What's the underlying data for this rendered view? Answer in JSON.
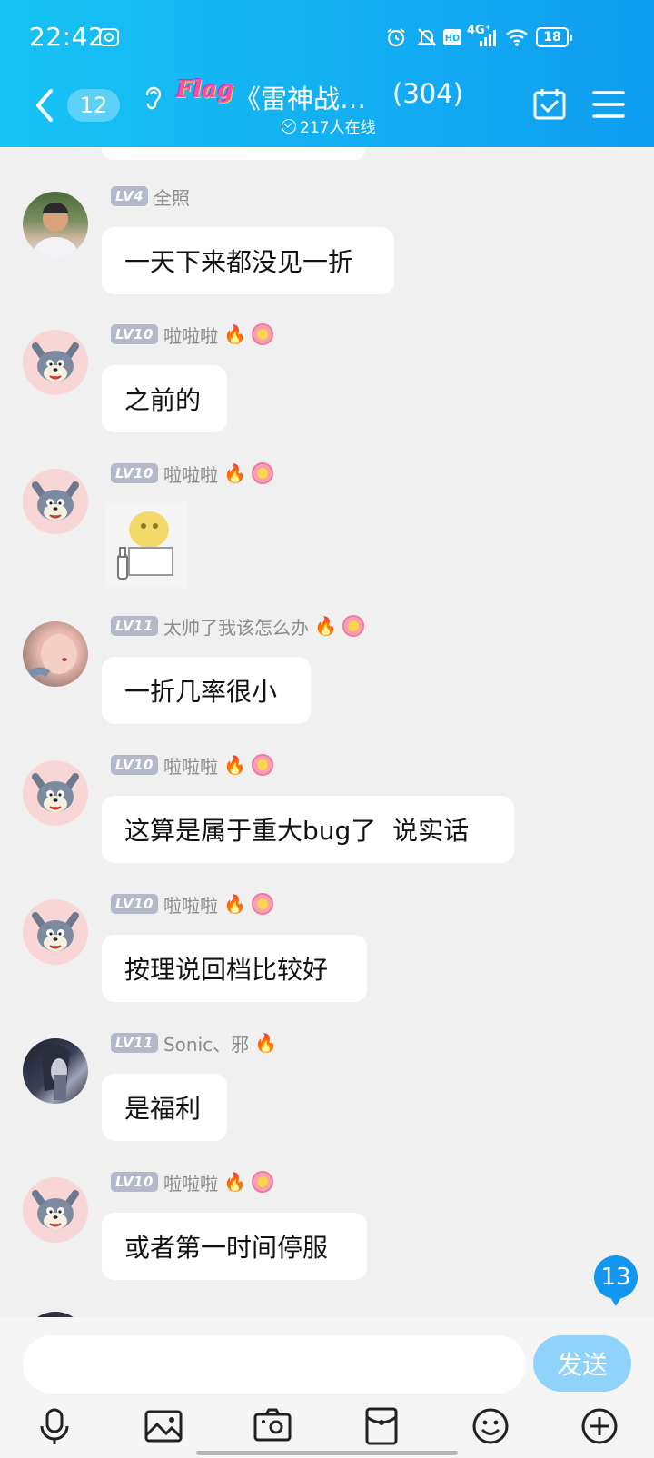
{
  "status_bar": {
    "time": "22:42",
    "network": "4G⁺",
    "battery": "18"
  },
  "nav": {
    "unread_count": "12",
    "flag_text": "Flag",
    "title": "《雷神战…",
    "member_count": "(304)",
    "online": "217人在线"
  },
  "messages": [
    {
      "level": "LV4",
      "sender": "全照",
      "avatar": "man",
      "type": "text",
      "text": "一天下来都没见一折",
      "fire": false,
      "flower": false
    },
    {
      "level": "LV10",
      "sender": "啦啦啦",
      "avatar": "cat",
      "type": "text",
      "text": "之前的",
      "fire": true,
      "flower": true
    },
    {
      "level": "LV10",
      "sender": "啦啦啦",
      "avatar": "cat",
      "type": "sticker",
      "text": "",
      "fire": true,
      "flower": true
    },
    {
      "level": "LV11",
      "sender": "太帅了我该怎么办",
      "avatar": "baby",
      "type": "text",
      "text": "一折几率很小",
      "fire": true,
      "flower": true
    },
    {
      "level": "LV10",
      "sender": "啦啦啦",
      "avatar": "cat",
      "type": "text",
      "text": "这算是属于重大bug了  说实话",
      "fire": true,
      "flower": true
    },
    {
      "level": "LV10",
      "sender": "啦啦啦",
      "avatar": "cat",
      "type": "text",
      "text": "按理说回档比较好",
      "fire": true,
      "flower": true
    },
    {
      "level": "LV11",
      "sender": "Sonic、邪",
      "avatar": "dark",
      "type": "text",
      "text": "是福利",
      "fire": true,
      "flower": false
    },
    {
      "level": "LV10",
      "sender": "啦啦啦",
      "avatar": "cat",
      "type": "text",
      "text": "或者第一时间停服",
      "fire": true,
      "flower": true
    }
  ],
  "new_message_count": "13",
  "input": {
    "placeholder": "",
    "send_label": "发送"
  },
  "toolbar": [
    "mic-icon",
    "image-icon",
    "camera-icon",
    "red-packet-icon",
    "emoji-icon",
    "plus-icon"
  ]
}
